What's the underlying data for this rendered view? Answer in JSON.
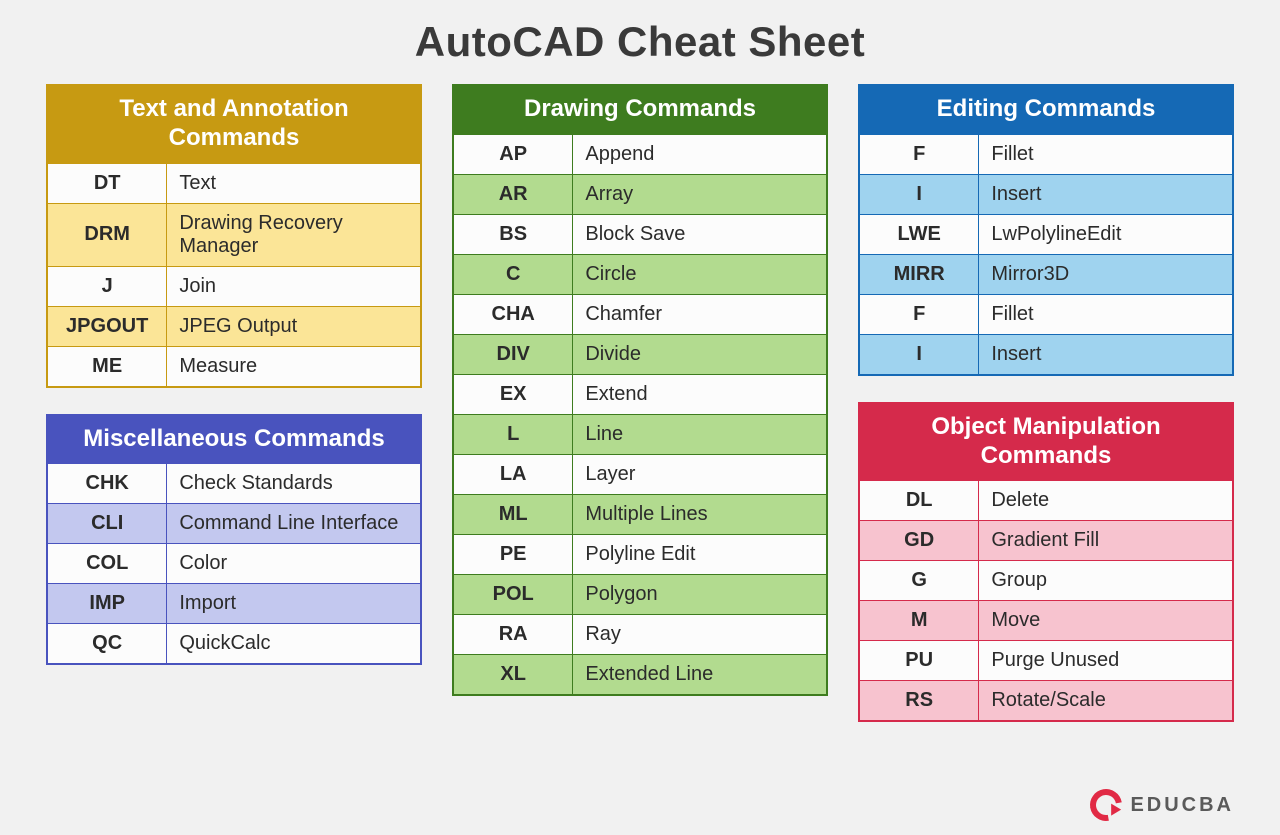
{
  "page_title": "AutoCAD Cheat Sheet",
  "brand": "EDUCBA",
  "tables": {
    "text_annotation": {
      "title": "Text and Annotation Commands",
      "rows": [
        {
          "cmd": "DT",
          "desc": "Text"
        },
        {
          "cmd": "DRM",
          "desc": "Drawing Recovery Manager"
        },
        {
          "cmd": "J",
          "desc": "Join"
        },
        {
          "cmd": "JPGOUT",
          "desc": "JPEG Output"
        },
        {
          "cmd": "ME",
          "desc": "Measure"
        }
      ]
    },
    "misc": {
      "title": "Miscellaneous Commands",
      "rows": [
        {
          "cmd": "CHK",
          "desc": "Check Standards"
        },
        {
          "cmd": "CLI",
          "desc": "Command Line Interface"
        },
        {
          "cmd": "COL",
          "desc": "Color"
        },
        {
          "cmd": "IMP",
          "desc": "Import"
        },
        {
          "cmd": "QC",
          "desc": "QuickCalc"
        }
      ]
    },
    "drawing": {
      "title": "Drawing Commands",
      "rows": [
        {
          "cmd": "AP",
          "desc": "Append"
        },
        {
          "cmd": "AR",
          "desc": "Array"
        },
        {
          "cmd": "BS",
          "desc": "Block Save"
        },
        {
          "cmd": "C",
          "desc": "Circle"
        },
        {
          "cmd": "CHA",
          "desc": "Chamfer"
        },
        {
          "cmd": "DIV",
          "desc": "Divide"
        },
        {
          "cmd": "EX",
          "desc": "Extend"
        },
        {
          "cmd": "L",
          "desc": "Line"
        },
        {
          "cmd": "LA",
          "desc": "Layer"
        },
        {
          "cmd": "ML",
          "desc": "Multiple Lines"
        },
        {
          "cmd": "PE",
          "desc": "Polyline Edit"
        },
        {
          "cmd": "POL",
          "desc": "Polygon"
        },
        {
          "cmd": "RA",
          "desc": "Ray"
        },
        {
          "cmd": "XL",
          "desc": "Extended Line"
        }
      ]
    },
    "editing": {
      "title": "Editing Commands",
      "rows": [
        {
          "cmd": "F",
          "desc": "Fillet"
        },
        {
          "cmd": "I",
          "desc": "Insert"
        },
        {
          "cmd": "LWE",
          "desc": "LwPolylineEdit"
        },
        {
          "cmd": "MIRR",
          "desc": "Mirror3D"
        },
        {
          "cmd": "F",
          "desc": "Fillet"
        },
        {
          "cmd": "I",
          "desc": "Insert"
        }
      ]
    },
    "object_manip": {
      "title": "Object Manipulation Commands",
      "rows": [
        {
          "cmd": "DL",
          "desc": "Delete"
        },
        {
          "cmd": "GD",
          "desc": "Gradient Fill"
        },
        {
          "cmd": "G",
          "desc": "Group"
        },
        {
          "cmd": "M",
          "desc": "Move"
        },
        {
          "cmd": "PU",
          "desc": "Purge Unused"
        },
        {
          "cmd": "RS",
          "desc": "Rotate/Scale"
        }
      ]
    }
  }
}
